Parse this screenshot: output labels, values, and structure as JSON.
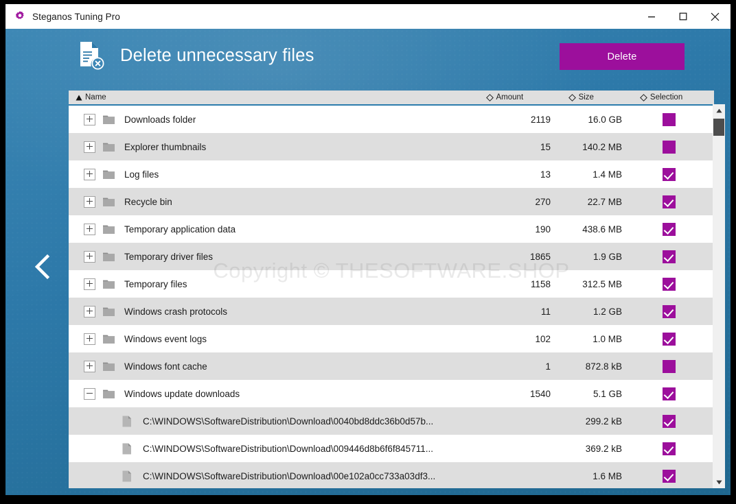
{
  "window": {
    "title": "Steganos Tuning Pro",
    "app_icon": "gear-icon",
    "controls": {
      "minimize": "minimize-icon",
      "maximize": "maximize-icon",
      "close": "close-icon"
    }
  },
  "header": {
    "icon": "document-delete-icon",
    "title": "Delete unnecessary files",
    "delete_label": "Delete",
    "back_icon": "chevron-left-icon",
    "accent_color": "#9c0f9c",
    "background_color": "#2d79a9"
  },
  "table": {
    "columns": [
      {
        "label": "Name",
        "sort": "ascending",
        "indicator": "triangle-up-icon"
      },
      {
        "label": "Amount",
        "sort": "none",
        "indicator": "diamond-icon"
      },
      {
        "label": "Size",
        "sort": "none",
        "indicator": "diamond-icon"
      },
      {
        "label": "Selection",
        "sort": "none",
        "indicator": "diamond-icon"
      }
    ],
    "rows": [
      {
        "type": "folder",
        "expander": "plus",
        "name": "Downloads folder",
        "amount": "2119",
        "size": "16.0 GB",
        "selection": "partial"
      },
      {
        "type": "folder",
        "expander": "plus",
        "name": "Explorer thumbnails",
        "amount": "15",
        "size": "140.2 MB",
        "selection": "partial"
      },
      {
        "type": "folder",
        "expander": "plus",
        "name": "Log files",
        "amount": "13",
        "size": "1.4 MB",
        "selection": "checked"
      },
      {
        "type": "folder",
        "expander": "plus",
        "name": "Recycle bin",
        "amount": "270",
        "size": "22.7 MB",
        "selection": "checked"
      },
      {
        "type": "folder",
        "expander": "plus",
        "name": "Temporary application data",
        "amount": "190",
        "size": "438.6 MB",
        "selection": "checked"
      },
      {
        "type": "folder",
        "expander": "plus",
        "name": "Temporary driver files",
        "amount": "1865",
        "size": "1.9 GB",
        "selection": "checked"
      },
      {
        "type": "folder",
        "expander": "plus",
        "name": "Temporary files",
        "amount": "1158",
        "size": "312.5 MB",
        "selection": "checked"
      },
      {
        "type": "folder",
        "expander": "plus",
        "name": "Windows crash protocols",
        "amount": "11",
        "size": "1.2 GB",
        "selection": "checked"
      },
      {
        "type": "folder",
        "expander": "plus",
        "name": "Windows event logs",
        "amount": "102",
        "size": "1.0 MB",
        "selection": "checked"
      },
      {
        "type": "folder",
        "expander": "plus",
        "name": "Windows font cache",
        "amount": "1",
        "size": "872.8 kB",
        "selection": "partial"
      },
      {
        "type": "folder",
        "expander": "minus",
        "name": "Windows update downloads",
        "amount": "1540",
        "size": "5.1 GB",
        "selection": "checked"
      },
      {
        "type": "file",
        "expander": "none",
        "name": "C:\\WINDOWS\\SoftwareDistribution\\Download\\0040bd8ddc36b0d57b...",
        "amount": "",
        "size": "299.2 kB",
        "selection": "checked"
      },
      {
        "type": "file",
        "expander": "none",
        "name": "C:\\WINDOWS\\SoftwareDistribution\\Download\\009446d8b6f6f845711...",
        "amount": "",
        "size": "369.2 kB",
        "selection": "checked"
      },
      {
        "type": "file",
        "expander": "none",
        "name": "C:\\WINDOWS\\SoftwareDistribution\\Download\\00e102a0cc733a03df3...",
        "amount": "",
        "size": "1.6 MB",
        "selection": "checked"
      }
    ]
  },
  "scrollbar": {
    "up_icon": "triangle-up-icon",
    "down_icon": "triangle-down-icon"
  },
  "watermark": {
    "text": "Copyright © THESOFTWARE.SHOP"
  }
}
